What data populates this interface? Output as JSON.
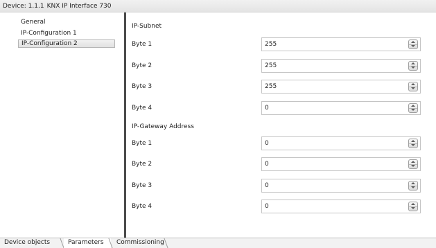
{
  "header": {
    "device_label": "Device: 1.1.1",
    "device_name": "KNX IP Interface 730"
  },
  "sidebar": {
    "items": [
      {
        "label": "General",
        "selected": false
      },
      {
        "label": "IP-Configuration 1",
        "selected": false
      },
      {
        "label": "IP-Configuration 2",
        "selected": true
      }
    ]
  },
  "panel": {
    "subnet": {
      "title": "IP-Subnet",
      "fields": [
        {
          "label": "Byte 1",
          "value": "255"
        },
        {
          "label": "Byte 2",
          "value": "255"
        },
        {
          "label": "Byte 3",
          "value": "255"
        },
        {
          "label": "Byte 4",
          "value": "0"
        }
      ]
    },
    "gateway": {
      "title": "IP-Gateway Address",
      "fields": [
        {
          "label": "Byte 1",
          "value": "0"
        },
        {
          "label": "Byte 2",
          "value": "0"
        },
        {
          "label": "Byte 3",
          "value": "0"
        },
        {
          "label": "Byte 4",
          "value": "0"
        }
      ]
    }
  },
  "tabs": [
    {
      "label": "Device objects",
      "active": false
    },
    {
      "label": "Parameters",
      "active": true
    },
    {
      "label": "Commissioning",
      "active": false
    }
  ],
  "colors": {
    "splitter": "#4a4a4a",
    "field_border": "#c4c4c4",
    "toolbar_bg": "#e4e4e4"
  }
}
